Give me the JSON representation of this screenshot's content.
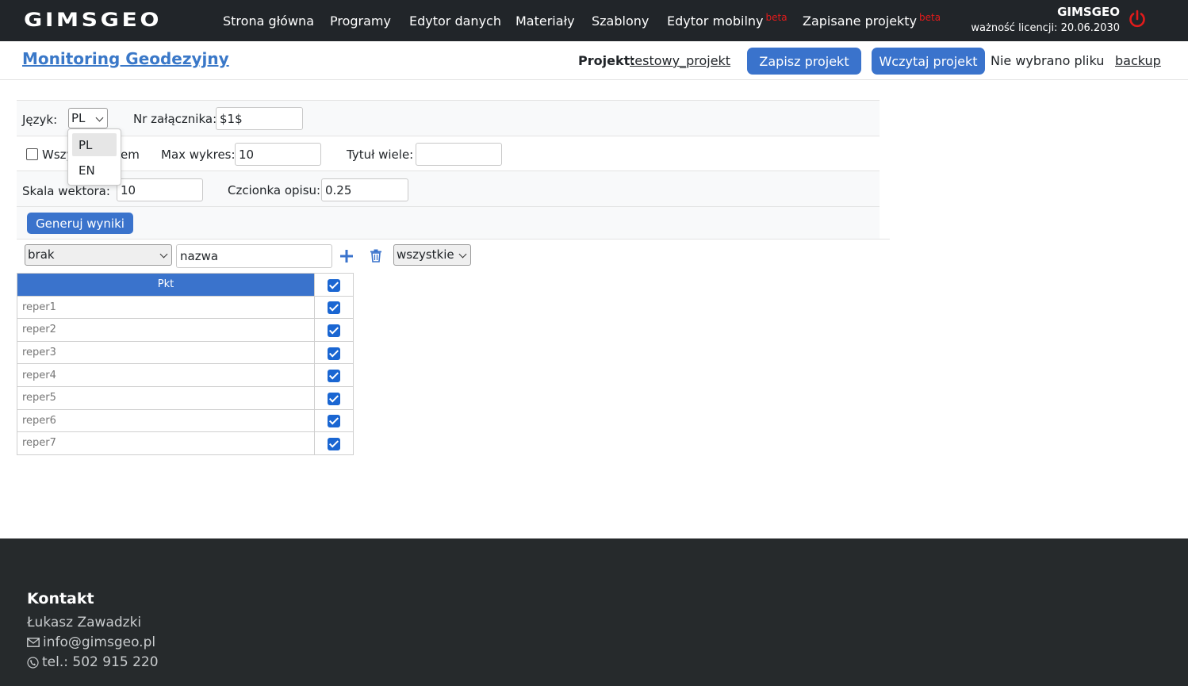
{
  "nav": {
    "brand": "GIMSGEO",
    "items": [
      {
        "label": "Strona główna",
        "badge": ""
      },
      {
        "label": "Programy",
        "badge": ""
      },
      {
        "label": "Edytor danych",
        "badge": ""
      },
      {
        "label": "Materiały",
        "badge": ""
      },
      {
        "label": "Szablony",
        "badge": ""
      },
      {
        "label": "Edytor mobilny",
        "badge": "beta"
      },
      {
        "label": "Zapisane projekty",
        "badge": "beta"
      }
    ],
    "user": "GIMSGEO",
    "license": "ważność licencji: 20.06.2030",
    "power_icon": "power-icon",
    "colors": {
      "navbar": "#212529",
      "badge": "#e21b1b",
      "power": "#e21b1b"
    }
  },
  "header": {
    "title": "Monitoring Geodezyjny",
    "project_label": "Projekt:",
    "project_name": "testowy_projekt",
    "save_label": "Zapisz projekt",
    "load_label": "Wczytaj projekt",
    "no_file": "Nie wybrano pliku",
    "backup": "backup",
    "accent": "#3a73cc"
  },
  "form": {
    "language_label": "Język:",
    "language_value": "PL",
    "language_options": [
      "PL",
      "EN"
    ],
    "attachment_label": "Nr załącznika:",
    "attachment_value": "$1$",
    "all_label_left": "Wszy",
    "all_label_right": "em",
    "max_chart_label": "Max wykres:",
    "max_chart_value": "10",
    "multi_title_label": "Tytuł wiele:",
    "multi_title_value": "",
    "vector_scale_label": "Skala wektora:",
    "vector_scale_value": "10",
    "desc_font_label": "Czcionka opisu:",
    "desc_font_value": "0.25",
    "generate_label": "Generuj wyniki"
  },
  "toolbar": {
    "select_value": "brak",
    "name_value": "nazwa",
    "filter_value": "wszystkie",
    "add_icon": "plus-icon",
    "delete_icon": "trash-icon"
  },
  "table": {
    "header": "Pkt",
    "rows": [
      {
        "name": "reper1",
        "checked": true
      },
      {
        "name": "reper2",
        "checked": true
      },
      {
        "name": "reper3",
        "checked": true
      },
      {
        "name": "reper4",
        "checked": true
      },
      {
        "name": "reper5",
        "checked": true
      },
      {
        "name": "reper6",
        "checked": true
      },
      {
        "name": "reper7",
        "checked": true
      }
    ]
  },
  "footer": {
    "title": "Kontakt",
    "person": "Łukasz Zawadzki",
    "email": "info@gimsgeo.pl",
    "phone": "tel.: 502 915 220",
    "email_icon": "envelope-icon",
    "phone_icon": "phone-icon"
  }
}
